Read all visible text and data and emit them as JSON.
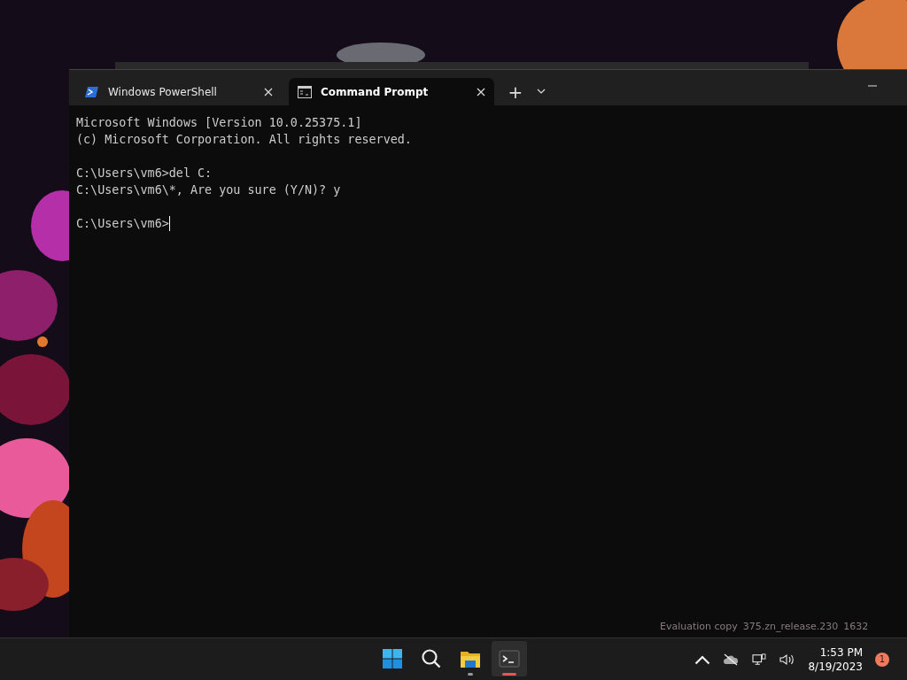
{
  "desktop": {
    "watermark": [
      "Evaluation copy",
      "375.zn_release.230",
      "1632"
    ]
  },
  "window": {
    "tabs": [
      {
        "label": "Windows PowerShell",
        "kind": "powershell",
        "selected": false
      },
      {
        "label": "Command Prompt",
        "kind": "cmd",
        "selected": true
      }
    ],
    "new_tab": "+"
  },
  "terminal": {
    "blocks": [
      {
        "lines": [
          "Microsoft Windows [Version 10.0.25375.1]",
          "(c) Microsoft Corporation. All rights reserved."
        ]
      },
      {
        "lines": [
          "C:\\Users\\vm6>del C:",
          "C:\\Users\\vm6\\*, Are you sure (Y/N)? y"
        ]
      },
      {
        "lines": [
          "C:\\Users\\vm6>"
        ]
      }
    ],
    "cursor": true
  },
  "taskbar": {
    "apps": [
      {
        "kind": "start",
        "selected": false,
        "running": false
      },
      {
        "kind": "search",
        "selected": false,
        "running": false
      },
      {
        "kind": "explorer",
        "selected": false,
        "running": true
      },
      {
        "kind": "terminal",
        "selected": true,
        "running": true
      }
    ],
    "time": "1:53 PM",
    "date": "8/19/2023",
    "notifications": "1"
  }
}
